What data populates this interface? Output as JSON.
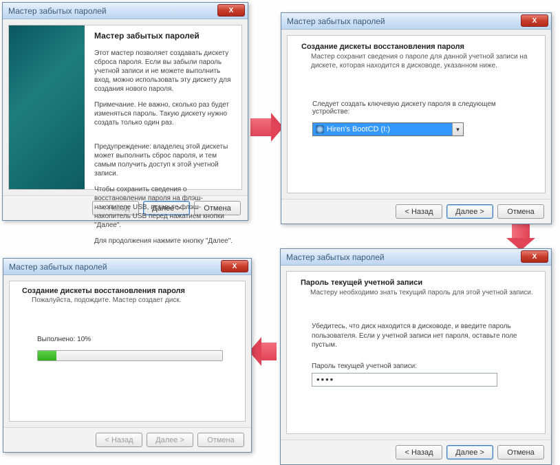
{
  "common": {
    "title": "Мастер забытых паролей",
    "close_x": "X",
    "back": "< Назад",
    "next": "Далее >",
    "cancel": "Отмена"
  },
  "d1": {
    "heading": "Мастер забытых паролей",
    "p1": "Этот мастер позволяет создавать дискету сброса пароля. Если вы забыли пароль учетной записи и не можете выполнить вход, можно использовать эту дискету для создания нового пароля.",
    "p2": "Примечание. Не важно, сколько раз будет изменяться пароль. Такую дискету нужно создать только один раз.",
    "p3": "Предупреждение: владелец этой дискеты может выполнить сброс пароля, и тем самым получить доступ к этой учетной записи.",
    "p4": "Чтобы сохранить сведения о восстановлении пароля на флэш-накопителе USB, вставьте флэш-накопитель USB перед нажатием кнопки \"Далее\".",
    "p5": "Для продолжения нажмите кнопку \"Далее\"."
  },
  "d2": {
    "heading": "Создание дискеты восстановления пароля",
    "sub": "Мастер сохранит сведения о пароле для данной учетной записи на дискете, которая находится в дисководе, указанном ниже.",
    "label": "Следует создать ключевую дискету пароля в следующем устройстве:",
    "combo_selected": "Hiren's BootCD (I:)"
  },
  "d3": {
    "heading": "Пароль текущей учетной записи",
    "sub": "Мастеру необходимо знать текущий пароль для этой учетной записи.",
    "info": "Убедитесь, что диск находится в дисководе, и введите пароль пользователя. Если у учетной записи нет пароля, оставьте поле пустым.",
    "pwd_label": "Пароль текущей учетной записи:",
    "pwd_value": "••••"
  },
  "d4": {
    "heading": "Создание дискеты восстановления пароля",
    "sub": "Пожалуйста, подождите. Мастер создает диск.",
    "progress_text": "Выполнено: 10%",
    "progress_percent": 10
  }
}
